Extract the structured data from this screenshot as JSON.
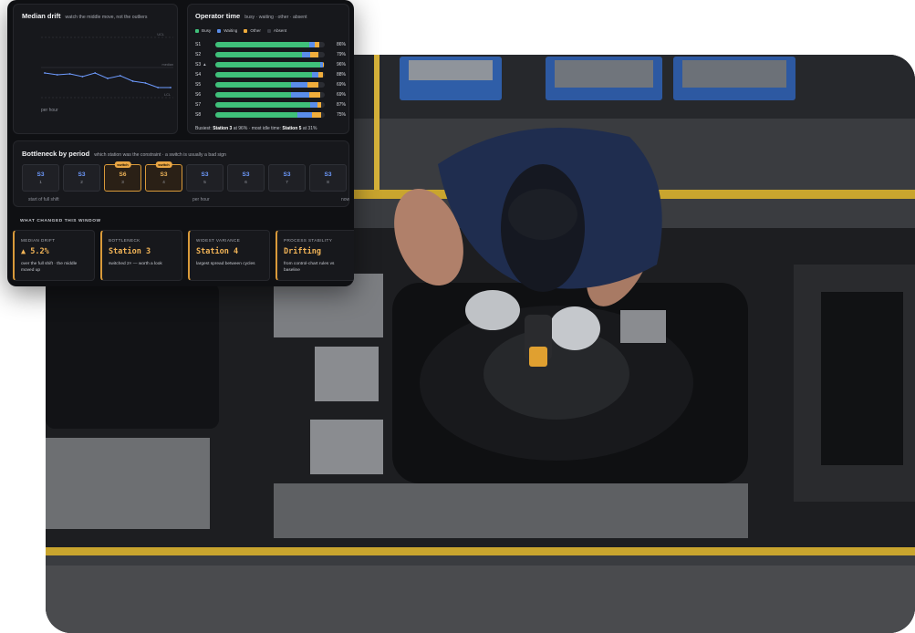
{
  "median_drift": {
    "title": "Median drift",
    "subtitle": "watch the middle move, not the outliers",
    "ucl_label": "UCL",
    "median_label": "median",
    "lcl_label": "LCL",
    "footer": "per hour",
    "line_color": "#6e9bff",
    "chart_data": {
      "type": "line",
      "values": [
        0.45,
        0.43,
        0.44,
        0.41,
        0.45,
        0.39,
        0.42,
        0.36,
        0.34,
        0.29,
        0.29
      ],
      "ylim": [
        0,
        1
      ]
    }
  },
  "operator_time": {
    "title": "Operator time",
    "subtitle": "busy · waiting · other · absent",
    "legend": [
      {
        "label": "Busy",
        "color": "#3fc07a"
      },
      {
        "label": "Waiting",
        "color": "#5a8dea"
      },
      {
        "label": "Other",
        "color": "#f0ad3c"
      },
      {
        "label": "Absent",
        "color": "#3a3c43"
      }
    ],
    "stations": [
      {
        "label": "S1",
        "trend": "",
        "busy": 86,
        "waiting": 5,
        "other": 4,
        "pct": "86%"
      },
      {
        "label": "S2",
        "trend": "",
        "busy": 79,
        "waiting": 8,
        "other": 7,
        "pct": "79%"
      },
      {
        "label": "S3",
        "trend": "▲",
        "busy": 96,
        "waiting": 2,
        "other": 1,
        "pct": "96%"
      },
      {
        "label": "S4",
        "trend": "",
        "busy": 88,
        "waiting": 6,
        "other": 4,
        "pct": "88%"
      },
      {
        "label": "S5",
        "trend": "",
        "busy": 69,
        "waiting": 15,
        "other": 10,
        "pct": "69%"
      },
      {
        "label": "S6",
        "trend": "",
        "busy": 69,
        "waiting": 17,
        "other": 10,
        "pct": "69%"
      },
      {
        "label": "S7",
        "trend": "",
        "busy": 87,
        "waiting": 6,
        "other": 4,
        "pct": "87%"
      },
      {
        "label": "S8",
        "trend": "",
        "busy": 75,
        "waiting": 13,
        "other": 9,
        "pct": "75%"
      }
    ],
    "summary_prefix": "Busiest: ",
    "summary_busiest": "Station 3",
    "summary_mid": " at 96% · most idle time: ",
    "summary_idle": "Station 5",
    "summary_suffix": " at 31%"
  },
  "bottleneck": {
    "title": "Bottleneck by period",
    "subtitle": "which station was the constraint · a switch is usually a bad sign",
    "periods": [
      {
        "station": "S3",
        "index": "1",
        "switch": false
      },
      {
        "station": "S3",
        "index": "2",
        "switch": false
      },
      {
        "station": "S6",
        "index": "3",
        "switch": true
      },
      {
        "station": "S3",
        "index": "4",
        "switch": true
      },
      {
        "station": "S3",
        "index": "5",
        "switch": false
      },
      {
        "station": "S3",
        "index": "6",
        "switch": false
      },
      {
        "station": "S3",
        "index": "7",
        "switch": false
      },
      {
        "station": "S3",
        "index": "8",
        "switch": false
      }
    ],
    "switch_label": "switch",
    "axis_left": "start of full shift",
    "axis_mid": "per hour",
    "axis_right": "now"
  },
  "what_changed": {
    "title": "WHAT CHANGED THIS WINDOW",
    "cards": [
      {
        "key": "MEDIAN DRIFT",
        "value": "▲ 5.2%",
        "desc": "over the full shift · the middle moved up"
      },
      {
        "key": "BOTTLENECK",
        "value": "Station 3",
        "desc": "switched 2× — worth a look"
      },
      {
        "key": "WIDEST VARIANCE",
        "value": "Station 4",
        "desc": "largest spread between cycles"
      },
      {
        "key": "PROCESS STABILITY",
        "value": "Drifting",
        "desc": "from control-chart rules vs baseline"
      }
    ]
  },
  "photo": {
    "icon": "factory-worker-photo"
  }
}
